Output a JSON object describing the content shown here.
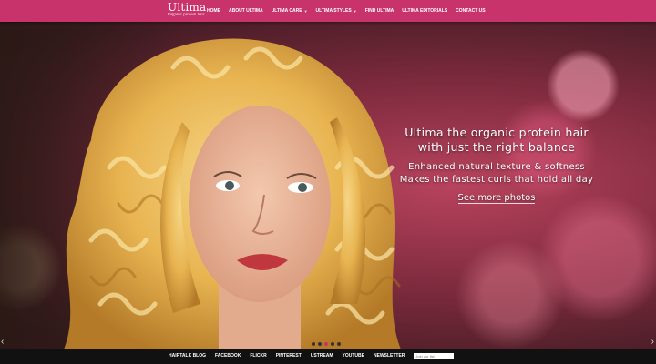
{
  "header": {
    "logo_name": "Ultima",
    "logo_tagline": "Organic protein hair",
    "nav": [
      {
        "label": "Home",
        "has_dropdown": false
      },
      {
        "label": "About Ultima",
        "has_dropdown": false
      },
      {
        "label": "Ultima Care",
        "has_dropdown": true
      },
      {
        "label": "Ultima Styles",
        "has_dropdown": true
      },
      {
        "label": "Find Ultima",
        "has_dropdown": false
      },
      {
        "label": "Ultima Editorials",
        "has_dropdown": false
      },
      {
        "label": "Contact Us",
        "has_dropdown": false
      }
    ]
  },
  "slide": {
    "title_line1": "Ultima the organic protein hair",
    "title_line2": "with just the right balance",
    "sub_line1": "Enhanced natural texture & softness",
    "sub_line2": "Makes the fastest curls that hold all day",
    "link": "See more photos"
  },
  "slider": {
    "prev_icon": "‹",
    "next_icon": "›",
    "dot_count": 5,
    "active_index": 2
  },
  "footer": {
    "links": [
      "Hairtalk Blog",
      "Facebook",
      "Flickr",
      "Pinterest",
      "Ustream",
      "Youtube",
      "Newsletter"
    ],
    "newsletter_placeholder": "Join our list"
  },
  "colors": {
    "brand": "#c8336b",
    "footer_bg": "#111111"
  }
}
